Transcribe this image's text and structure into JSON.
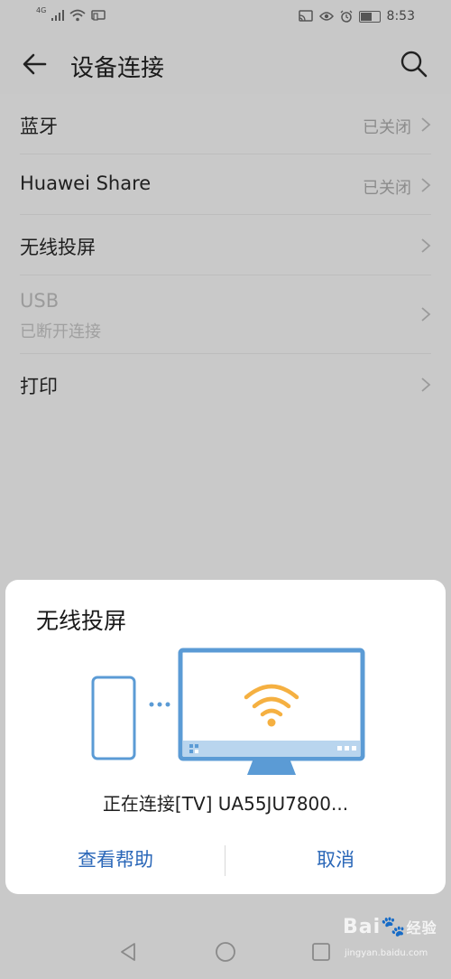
{
  "status_bar": {
    "network_label": "4G",
    "time": "8:53"
  },
  "app_bar": {
    "title": "设备连接"
  },
  "settings": {
    "items": [
      {
        "label": "蓝牙",
        "value": "已关闭"
      },
      {
        "label": "Huawei Share",
        "value": "已关闭"
      },
      {
        "label": "无线投屏",
        "value": ""
      },
      {
        "label": "USB",
        "sub": "已断开连接",
        "disabled": true
      },
      {
        "label": "打印",
        "value": ""
      }
    ]
  },
  "dialog": {
    "title": "无线投屏",
    "message": "正在连接[TV] UA55JU7800...",
    "help_label": "查看帮助",
    "cancel_label": "取消"
  },
  "watermark": {
    "brand": "Bai",
    "brand_cn": "经验",
    "site": "jingyan.baidu.com"
  },
  "colors": {
    "accent": "#2a67b8",
    "illustration_blue": "#5b9bd5",
    "wifi_orange": "#f5b041",
    "dim_background": "#c9c9c9"
  }
}
